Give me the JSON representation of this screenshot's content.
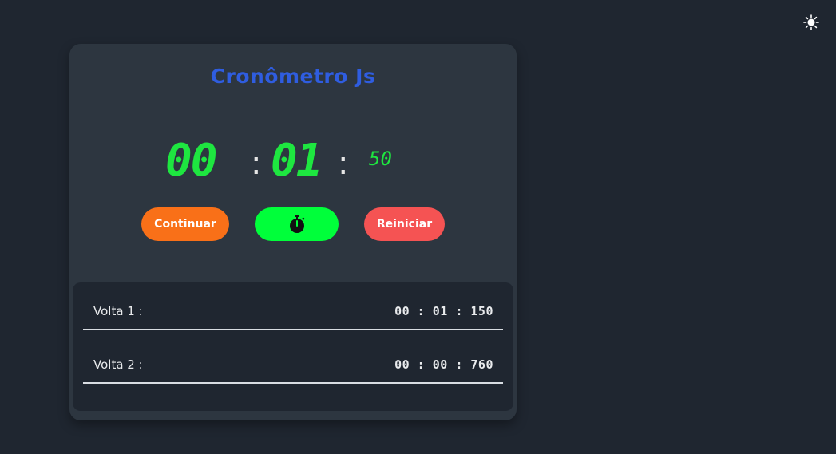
{
  "header": {
    "theme_toggle_icon": "sun-icon"
  },
  "card": {
    "title": "Cronômetro Js",
    "display": {
      "minutes": "00",
      "seconds": "01",
      "milliseconds": "50",
      "separator": ":"
    },
    "buttons": {
      "continue_label": "Continuar",
      "lap_icon": "stopwatch-icon",
      "reset_label": "Reiniciar"
    },
    "laps": [
      {
        "label": "Volta 1 :",
        "time": "00 : 01 : 150"
      },
      {
        "label": "Volta 2 :",
        "time": "00 : 00 : 760"
      }
    ]
  },
  "colors": {
    "background": "#1f2630",
    "card": "#2d3640",
    "title": "#2f5de0",
    "digits": "#1ee640",
    "continue": "#f97018",
    "lap": "#00ff3a",
    "reset": "#f55353"
  }
}
